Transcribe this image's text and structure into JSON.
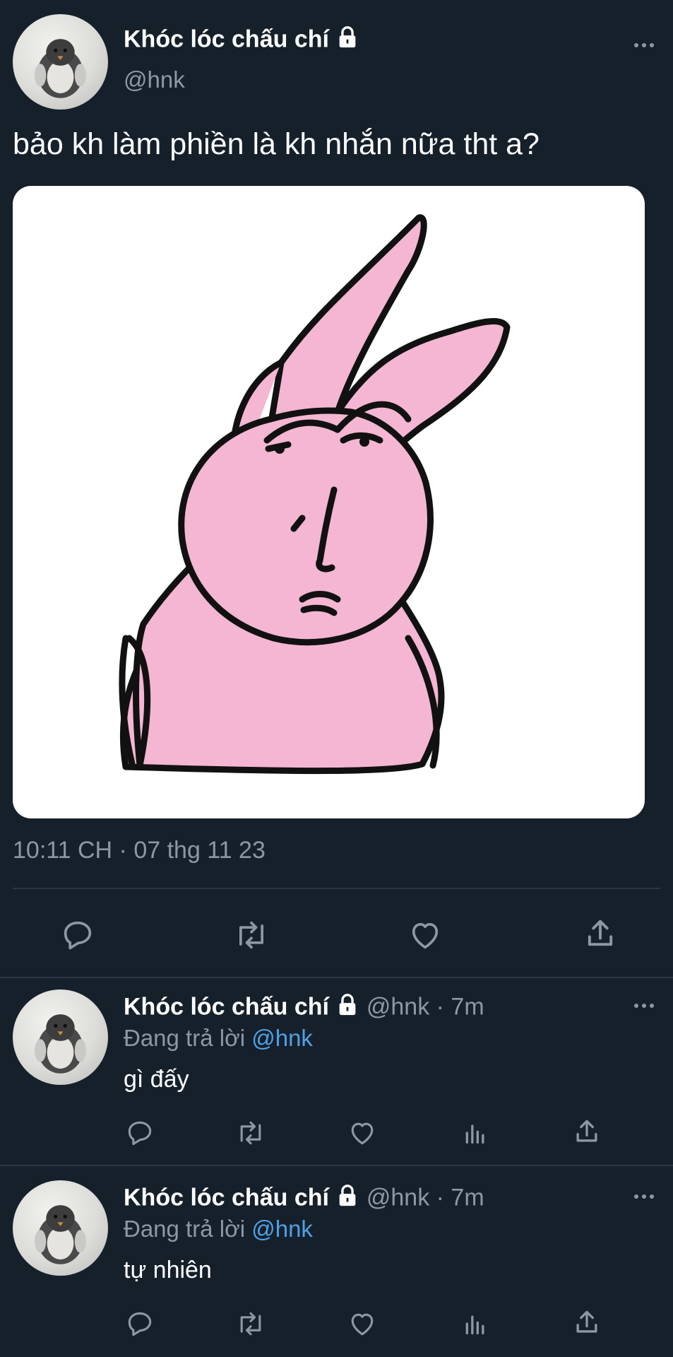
{
  "tweet": {
    "author_name": "Khóc lóc chấu chí",
    "handle": "@hnk",
    "text": "bảo kh làm phiền là kh nhắn nữa tht a?",
    "timestamp": "10:11 CH · 07 thg 11 23",
    "actions": [
      "reply-icon",
      "retweet-icon",
      "like-icon",
      "share-icon"
    ]
  },
  "replies": [
    {
      "author_name": "Khóc lóc chấu chí",
      "handle": "@hnk",
      "time": "· 7m",
      "replying_prefix": "Đang trả lời",
      "replying_to": "@hnk",
      "text": "gì đấy"
    },
    {
      "author_name": "Khóc lóc chấu chí",
      "handle": "@hnk",
      "time": "· 7m",
      "replying_prefix": "Đang trả lời",
      "replying_to": "@hnk",
      "text": "tự nhiên"
    }
  ],
  "colors": {
    "background": "#16202b",
    "muted": "#8b98a5",
    "link": "#4ea1e6",
    "bunny_pink": "#f4b6d2"
  }
}
